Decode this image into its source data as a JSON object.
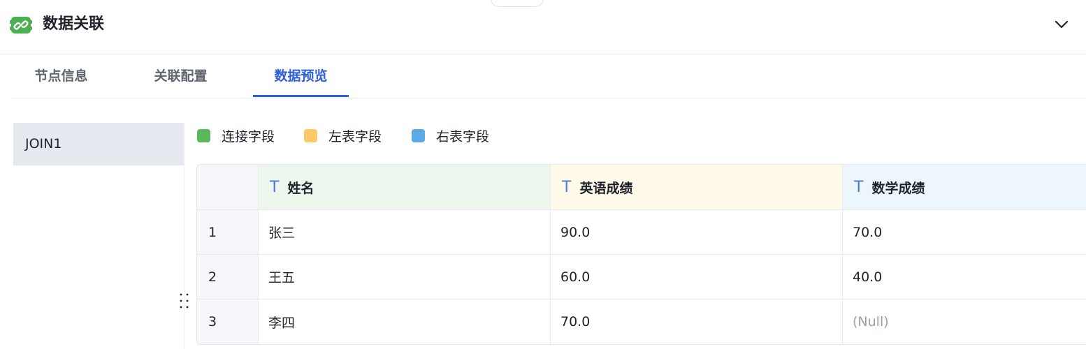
{
  "header": {
    "title": "数据关联",
    "logo_icon": "link-chain-icon",
    "collapse_icon": "chevron-down-icon"
  },
  "tabs": [
    {
      "label": "节点信息",
      "active": false
    },
    {
      "label": "关联配置",
      "active": false
    },
    {
      "label": "数据预览",
      "active": true
    }
  ],
  "sidebar": {
    "items": [
      {
        "label": "JOIN1",
        "selected": true
      }
    ]
  },
  "legend": [
    {
      "label": "连接字段",
      "color": "#5cb85c"
    },
    {
      "label": "左表字段",
      "color": "#fcc96a"
    },
    {
      "label": "右表字段",
      "color": "#5aaae6"
    }
  ],
  "table": {
    "type_icon": "T",
    "columns": [
      {
        "name": "姓名",
        "kind": "join",
        "bg": "#edf7ee"
      },
      {
        "name": "英语成绩",
        "kind": "left",
        "bg": "#fffaea"
      },
      {
        "name": "数学成绩",
        "kind": "right",
        "bg": "#eef6fd"
      }
    ],
    "rows": [
      {
        "index": "1",
        "cells": [
          "张三",
          "90.0",
          "70.0"
        ]
      },
      {
        "index": "2",
        "cells": [
          "王五",
          "60.0",
          "40.0"
        ]
      },
      {
        "index": "3",
        "cells": [
          "李四",
          "70.0",
          "(Null)"
        ]
      }
    ]
  }
}
